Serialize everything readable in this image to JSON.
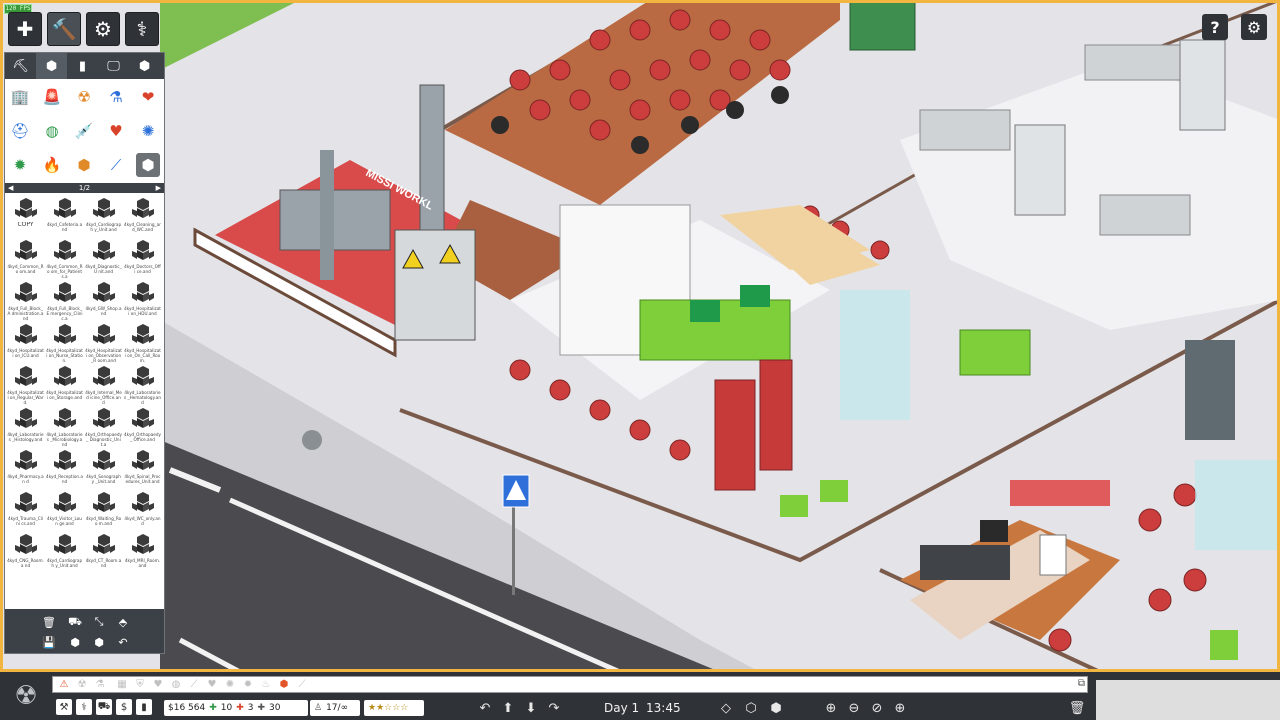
{
  "fps_badge": "120 FPS",
  "toolbar_top": [
    {
      "name": "build-button",
      "glyph": "✚"
    },
    {
      "name": "hammer-tool-button",
      "glyph": "🔨"
    },
    {
      "name": "gears-button",
      "glyph": "⚙"
    },
    {
      "name": "stethoscope-button",
      "glyph": "⚕"
    }
  ],
  "category_tabs": [
    {
      "name": "construction-crane-tab",
      "glyph": "⛏"
    },
    {
      "name": "object-tab",
      "glyph": "⬢"
    },
    {
      "name": "wall-tab",
      "glyph": "▮"
    },
    {
      "name": "monitor-tab",
      "glyph": "🖵"
    },
    {
      "name": "blueprint-tab",
      "glyph": "⬢"
    }
  ],
  "object_icons": [
    {
      "name": "building-icon",
      "glyph": "🏢",
      "color": "#d9432b"
    },
    {
      "name": "siren-icon",
      "glyph": "🚨",
      "color": "#d9432b"
    },
    {
      "name": "radiation-icon",
      "glyph": "☢",
      "color": "#e08a2a"
    },
    {
      "name": "flask-icon",
      "glyph": "⚗",
      "color": "#2b6fd9"
    },
    {
      "name": "heartbeat-icon",
      "glyph": "❤",
      "color": "#d9432b"
    },
    {
      "name": "nurse-cap-icon",
      "glyph": "⛑",
      "color": "#2b6fd9"
    },
    {
      "name": "globe-icon",
      "glyph": "◍",
      "color": "#2f9a4a"
    },
    {
      "name": "syringe-icon",
      "glyph": "💉",
      "color": "#d9432b"
    },
    {
      "name": "heart-bandage-icon",
      "glyph": "♥",
      "color": "#d9432b"
    },
    {
      "name": "brain-icon",
      "glyph": "✺",
      "color": "#2b6fd9"
    },
    {
      "name": "virus-icon",
      "glyph": "✹",
      "color": "#2f9a4a"
    },
    {
      "name": "fire-icon",
      "glyph": "🔥",
      "color": "#d9432b"
    },
    {
      "name": "cube-icon",
      "glyph": "⬢",
      "color": "#e08a2a"
    },
    {
      "name": "bandage-icon",
      "glyph": "⟋",
      "color": "#2b6fd9"
    },
    {
      "name": "blueprint-stack-icon",
      "glyph": "⬢",
      "color": "#8a8a8a"
    }
  ],
  "pager": {
    "label": "1/2"
  },
  "blueprints": [
    "COPY",
    "4kyd_Cafeteria.and",
    "4kyd_Cardiograph y_Unit.and",
    "4kyd_Cleaning_ar d_WC.and",
    "4kyd_Common_Ro om.and",
    "4kyd_Common_Ro om_for_Patients.a",
    "4kyd_Diagnostic_U nit.and",
    "4kyd_Doctors_Offi ce.and",
    "4kyd_Full_Block_A dministration.and",
    "4kyd_Full_Block_E mergency_Clinic.a",
    "4kyd_GW_Shop.a nd",
    "4kyd_Hospitalizati on_HDU.and",
    "4kyd_Hospitalizati on_ICU.and",
    "4kyd_Hospitalizati on_Nurse_Station.",
    "4kyd_Hospitalizati on_Observation_R oom.and",
    "4kyd_Hospitalizati on_On_Call_Room.",
    "4kyd_Hospitalizati on_Regular_Ward.",
    "4kyd_Hospitalizati on_Storage.and",
    "4kyd_Internal_Med icine_Office.and",
    "4kyd_Laboratories _Hematology.and",
    "4kyd_Laboratories _Histology.and",
    "4kyd_Laboratories _Microbiology.and",
    "4kyd_Orthopaedy_ Diagnostic_Unit.a",
    "4kyd_Orthopaedy_ Office.and",
    "4kyd_Pharmacy.an d",
    "4kyd_Reception.a nd",
    "4kyd_Sonography _Unit.and",
    "4kyd_Spinal_Proc edures_Unit.and",
    "4kyd_Trauma_Clini cs.and",
    "4kyd_Visitor_Loun ge.and",
    "4kyd_Waiting_Roo m.and",
    "4kyd_WC_only.and",
    "4kyd_CNG_Room.a nd",
    "4kyd_Cardiograph y_Unit.and",
    "4kyd_CT_Room.and",
    "4kyd_MRI_Room.and"
  ],
  "bp_tools": [
    {
      "name": "delete-icon",
      "glyph": "🗑"
    },
    {
      "name": "bulldozer-icon",
      "glyph": "⛟"
    },
    {
      "name": "resize-icon",
      "glyph": "⤡"
    },
    {
      "name": "stamp-icon",
      "glyph": "⬘"
    },
    {
      "name": "save-icon",
      "glyph": "💾"
    },
    {
      "name": "add-blueprint-icon",
      "glyph": "⬢"
    },
    {
      "name": "remove-blueprint-icon",
      "glyph": "⬢"
    },
    {
      "name": "undo-icon",
      "glyph": "↶"
    }
  ],
  "top_right": [
    {
      "name": "help-button",
      "glyph": "?"
    },
    {
      "name": "settings-button",
      "glyph": "⚙"
    }
  ],
  "signage": {
    "mission": "MISSI WORKL"
  },
  "status_bar": {
    "money": "$16 564",
    "staff_count": "10",
    "patients_count": "3",
    "visitors_count": "30",
    "capacity": "17/∞",
    "rating_stars": "★★☆☆☆",
    "day": "Day 1",
    "time": "13:45"
  }
}
